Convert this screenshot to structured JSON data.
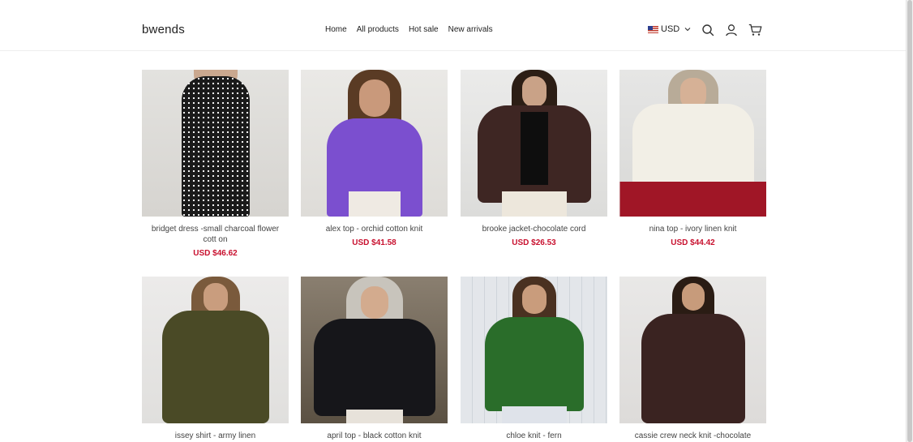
{
  "store": {
    "name": "bwends"
  },
  "nav": [
    {
      "label": "Home"
    },
    {
      "label": "All products"
    },
    {
      "label": "Hot sale"
    },
    {
      "label": "New arrivals"
    }
  ],
  "currency": {
    "label": "USD",
    "flag_icon": "us-flag-icon"
  },
  "header_icons": [
    "search-icon",
    "account-icon",
    "cart-icon"
  ],
  "colors": {
    "price": "#c8102e",
    "text": "#444444"
  },
  "products": [
    {
      "name": "bridget dress -small charcoal flower cott on",
      "price": "USD $46.62"
    },
    {
      "name": "alex top - orchid cotton knit",
      "price": "USD $41.58"
    },
    {
      "name": "brooke jacket-chocolate cord",
      "price": "USD $26.53"
    },
    {
      "name": "nina top - ivory linen knit",
      "price": "USD $44.42"
    },
    {
      "name": "issey shirt - army linen",
      "price": ""
    },
    {
      "name": "april top - black cotton knit",
      "price": ""
    },
    {
      "name": "chloe knit - fern",
      "price": ""
    },
    {
      "name": "cassie crew neck knit -chocolate cashme",
      "price": ""
    }
  ]
}
